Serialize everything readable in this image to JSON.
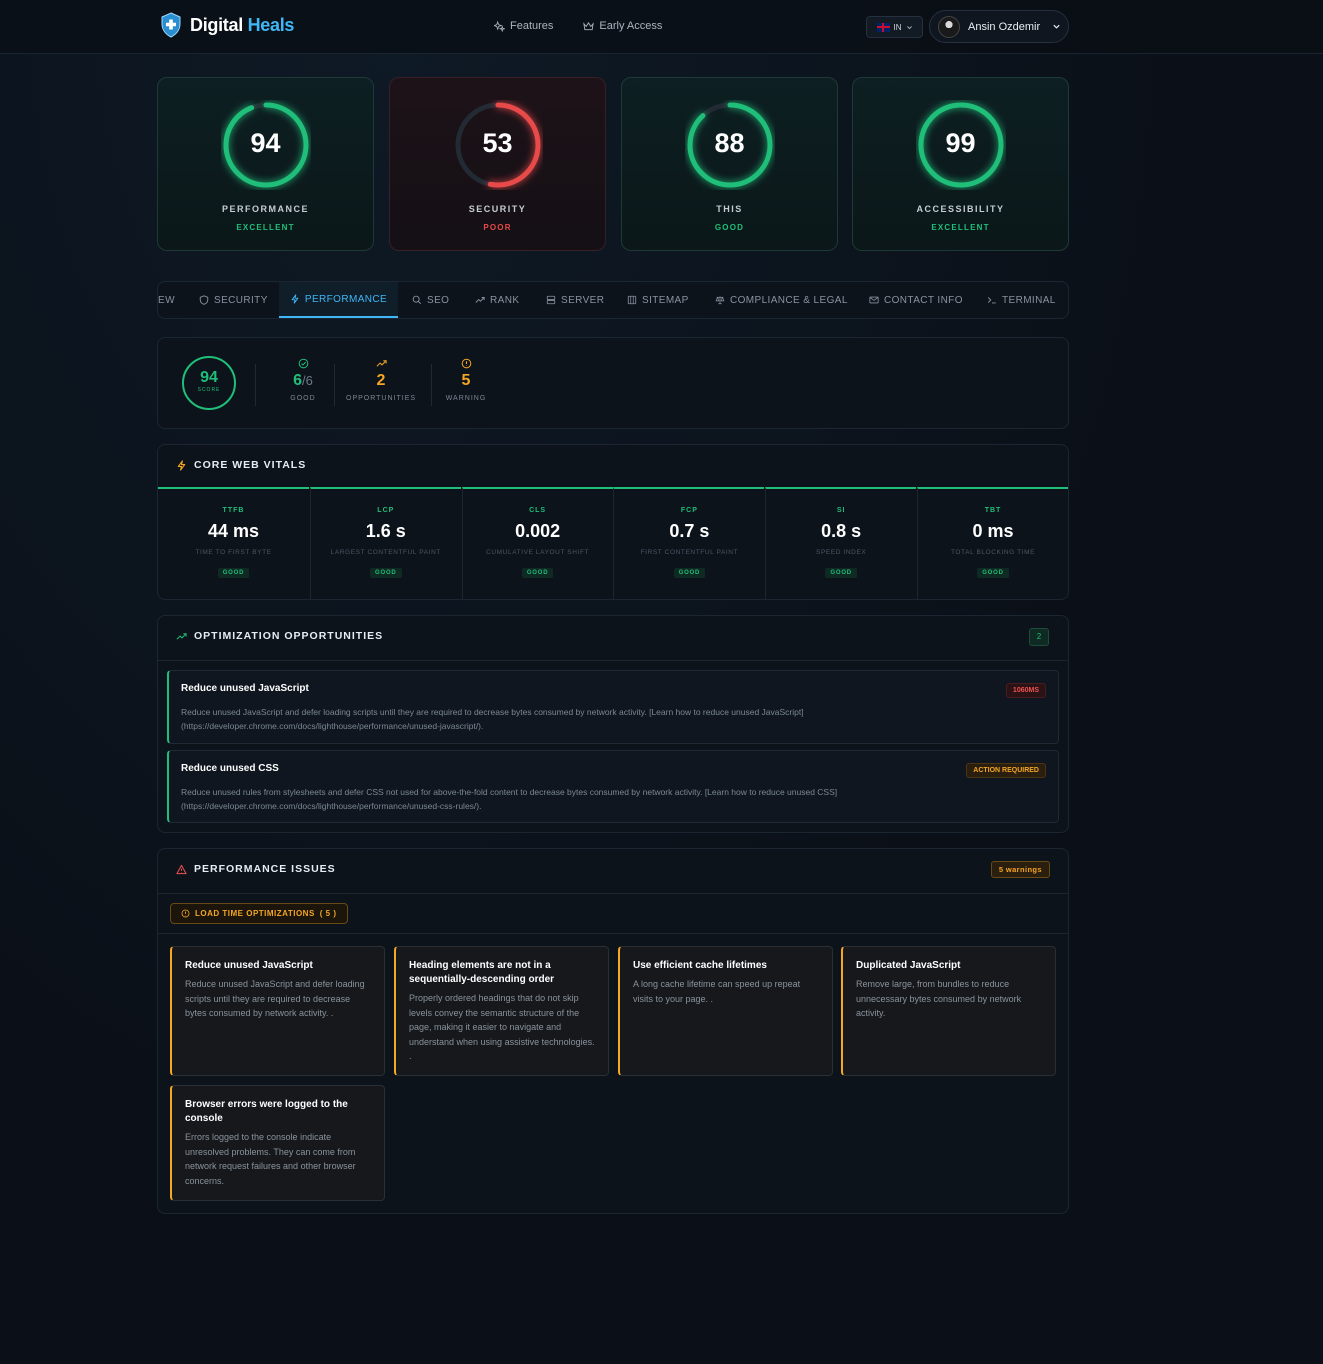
{
  "header": {
    "brand_first": "Digital",
    "brand_second": "Heals",
    "nav": [
      {
        "label": "Features",
        "icon": "sparkles-icon"
      },
      {
        "label": "Early Access",
        "icon": "crown-icon"
      }
    ],
    "language": "IN",
    "user_name": "Ansin Ozdemir"
  },
  "scores": [
    {
      "value": "94",
      "label": "PERFORMANCE",
      "grade": "EXCELLENT",
      "color": "#1fbf7a"
    },
    {
      "value": "53",
      "label": "SECURITY",
      "grade": "POOR",
      "color": "#e84a4a"
    },
    {
      "value": "88",
      "label": "THIS",
      "grade": "GOOD",
      "color": "#1fbf7a"
    },
    {
      "value": "99",
      "label": "ACCESSIBILITY",
      "grade": "EXCELLENT",
      "color": "#1fbf7a"
    }
  ],
  "tabs": [
    {
      "label": "EW"
    },
    {
      "label": "SECURITY",
      "icon": "shield-icon"
    },
    {
      "label": "PERFORMANCE",
      "icon": "bolt-icon"
    },
    {
      "label": "SEO",
      "icon": "search-icon"
    },
    {
      "label": "RANK",
      "icon": "trending-up-icon"
    },
    {
      "label": "SERVER",
      "icon": "server-icon"
    },
    {
      "label": "SITEMAP",
      "icon": "sitemap-icon"
    },
    {
      "label": "COMPLIANCE & LEGAL",
      "icon": "scale-icon"
    },
    {
      "label": "CONTACT INFO",
      "icon": "mail-icon"
    },
    {
      "label": "TERMINAL",
      "icon": "terminal-icon"
    }
  ],
  "summary": {
    "score": "94",
    "score_label": "SCORE",
    "good_value": "6",
    "good_total": "/6",
    "good_label": "GOOD",
    "opportunities_value": "2",
    "opportunities_label": "OPPORTUNITIES",
    "warning_value": "5",
    "warning_label": "WARNING"
  },
  "vitals": {
    "title": "CORE WEB VITALS",
    "items": [
      {
        "key": "TTFB",
        "value": "44 ms",
        "desc": "TIME TO FIRST BYTE",
        "status": "GOOD"
      },
      {
        "key": "LCP",
        "value": "1.6 s",
        "desc": "LARGEST CONTENTFUL PAINT",
        "status": "GOOD"
      },
      {
        "key": "CLS",
        "value": "0.002",
        "desc": "CUMULATIVE LAYOUT SHIFT",
        "status": "GOOD"
      },
      {
        "key": "FCP",
        "value": "0.7 s",
        "desc": "FIRST CONTENTFUL PAINT",
        "status": "GOOD"
      },
      {
        "key": "SI",
        "value": "0.8 s",
        "desc": "SPEED INDEX",
        "status": "GOOD"
      },
      {
        "key": "TBT",
        "value": "0 ms",
        "desc": "TOTAL BLOCKING TIME",
        "status": "GOOD"
      }
    ]
  },
  "opportunities": {
    "title": "OPTIMIZATION OPPORTUNITIES",
    "count": "2",
    "items": [
      {
        "title": "Reduce unused JavaScript",
        "tag": "1060MS",
        "desc": "Reduce unused JavaScript and defer loading scripts until they are required to decrease bytes consumed by network activity. [Learn how to reduce unused JavaScript](https://developer.chrome.com/docs/lighthouse/performance/unused-javascript/)."
      },
      {
        "title": "Reduce unused CSS",
        "tag": "ACTION REQUIRED",
        "desc": "Reduce unused rules from stylesheets and defer CSS not used for above-the-fold content to decrease bytes consumed by network activity. [Learn how to reduce unused CSS](https://developer.chrome.com/docs/lighthouse/performance/unused-css-rules/)."
      }
    ]
  },
  "issues": {
    "title": "PERFORMANCE ISSUES",
    "badge": "5 warnings",
    "group_label": "LOAD TIME OPTIMIZATIONS",
    "group_count": "( 5 )",
    "items": [
      {
        "title": "Reduce unused JavaScript",
        "desc": "Reduce unused JavaScript and defer loading scripts until they are required to decrease bytes consumed by network activity. ."
      },
      {
        "title": "Heading elements are not in a sequentially-descending order",
        "desc": "Properly ordered headings that do not skip levels convey the semantic structure of the page, making it easier to navigate and understand when using assistive technologies. ."
      },
      {
        "title": "Use efficient cache lifetimes",
        "desc": "A long cache lifetime can speed up repeat visits to your page. ."
      },
      {
        "title": "Duplicated JavaScript",
        "desc": "Remove large, from bundles to reduce unnecessary bytes consumed by network activity."
      },
      {
        "title": "Browser errors were logged to the console",
        "desc": "Errors logged to the console indicate unresolved problems. They can come from network request failures and other browser concerns."
      }
    ]
  }
}
